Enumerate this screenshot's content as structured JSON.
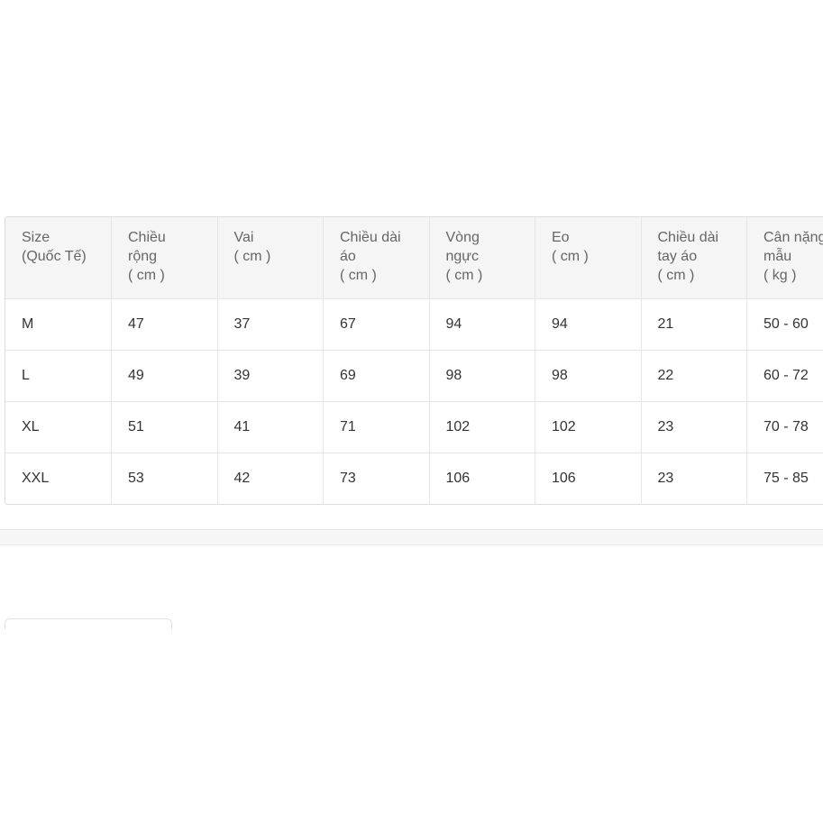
{
  "size_table": {
    "headers": [
      [
        "Size",
        "(Quốc Tế)"
      ],
      [
        "Chiều",
        "rộng",
        "( cm )"
      ],
      [
        "Vai",
        "( cm )"
      ],
      [
        "Chiều dài",
        "áo",
        "( cm )"
      ],
      [
        "Vòng",
        "ngực",
        "( cm )"
      ],
      [
        "Eo",
        "( cm )"
      ],
      [
        "Chiều dài",
        "tay áo",
        "( cm )"
      ],
      [
        "Cân nặng",
        "mẫu",
        "( kg )"
      ]
    ],
    "rows": [
      [
        "M",
        "47",
        "37",
        "67",
        "94",
        "94",
        "21",
        "50 - 60"
      ],
      [
        "L",
        "49",
        "39",
        "69",
        "98",
        "98",
        "22",
        "60 - 72"
      ],
      [
        "XL",
        "51",
        "41",
        "71",
        "102",
        "102",
        "23",
        "70 - 78"
      ],
      [
        "XXL",
        "53",
        "42",
        "73",
        "106",
        "106",
        "23",
        "75 - 85"
      ]
    ]
  }
}
